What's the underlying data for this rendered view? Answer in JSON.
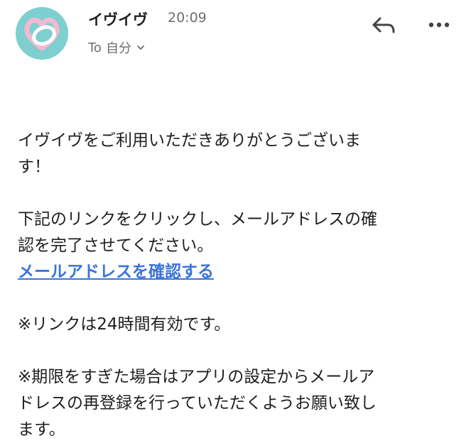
{
  "colors": {
    "avatar_bg": "#7ecfcf",
    "link": "#3b74d8",
    "text": "#1f1f1f",
    "muted": "#6e6e6e"
  },
  "header": {
    "sender_name": "イヴイヴ",
    "timestamp": "20:09",
    "recipient": {
      "prefix": "To",
      "name": "自分"
    },
    "avatar_icon": "heart-ring-logo-icon",
    "reply_icon": "reply-arrow-icon",
    "more_icon": "more-horizontal-icon"
  },
  "message": {
    "greeting_line1": "イヴイヴをご利用いただきありがとうございま",
    "greeting_line2": "す！",
    "instruction_line1": "下記のリンクをクリックし、メールアドレスの確",
    "instruction_line2": "認を完了させてください。",
    "confirm_link": "メールアドレスを確認する",
    "validity_note": "※リンクは24時間有効です。",
    "expiry_line1": "※期限をすぎた場合はアプリの設定からメールア",
    "expiry_line2": "ドレスの再登録を行っていただくようお願い致し",
    "expiry_line3": "ます。"
  }
}
